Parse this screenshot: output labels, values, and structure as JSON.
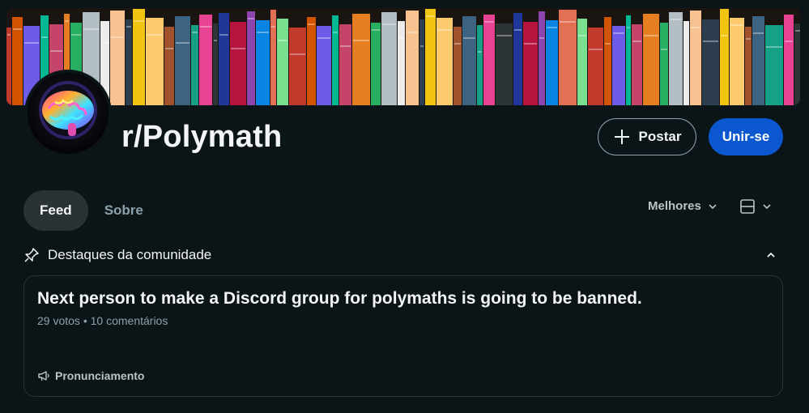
{
  "subreddit": {
    "name": "r/Polymath"
  },
  "banner": {
    "description_icon": "bookshelf-banner"
  },
  "avatar": {
    "icon": "colorful-brain-icon"
  },
  "buttons": {
    "post_label": "Postar",
    "join_label": "Unir-se"
  },
  "tabs": [
    {
      "label": "Feed",
      "active": true
    },
    {
      "label": "Sobre",
      "active": false
    }
  ],
  "sort": {
    "label": "Melhores"
  },
  "highlights": {
    "label": "Destaques da comunidade"
  },
  "pinned_post": {
    "title": "Next person to make a Discord group for polymaths is going to be banned.",
    "votes": "29 votos",
    "separator": "•",
    "comments": "10 comentários",
    "flair": "Pronunciamento"
  },
  "colors": {
    "background": "#0b1416",
    "join_button": "#0a57d0",
    "muted_text": "#8ba2ad"
  }
}
